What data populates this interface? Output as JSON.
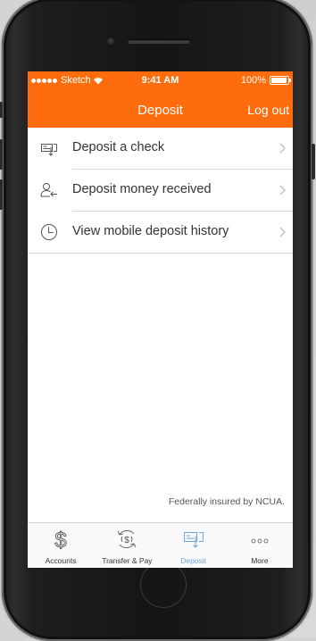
{
  "status_bar": {
    "carrier": "Sketch",
    "time": "9:41 AM",
    "battery": "100%"
  },
  "header": {
    "title": "Deposit",
    "logout_label": "Log out"
  },
  "menu": [
    {
      "label": "Deposit a check",
      "icon": "check-deposit-icon"
    },
    {
      "label": "Deposit money received",
      "icon": "person-receive-icon"
    },
    {
      "label": "View mobile deposit history",
      "icon": "clock-history-icon"
    }
  ],
  "footnote": "Federally insured by NCUA.",
  "tabs": [
    {
      "label": "Accounts",
      "icon": "dollar-icon"
    },
    {
      "label": "Transfer & Pay",
      "icon": "transfer-circle-icon"
    },
    {
      "label": "Deposit",
      "icon": "deposit-check-icon",
      "active": true
    },
    {
      "label": "More",
      "icon": "more-dots-icon"
    }
  ],
  "colors": {
    "brand": "#ff6c0d",
    "active_tab": "#6aa4d8"
  }
}
